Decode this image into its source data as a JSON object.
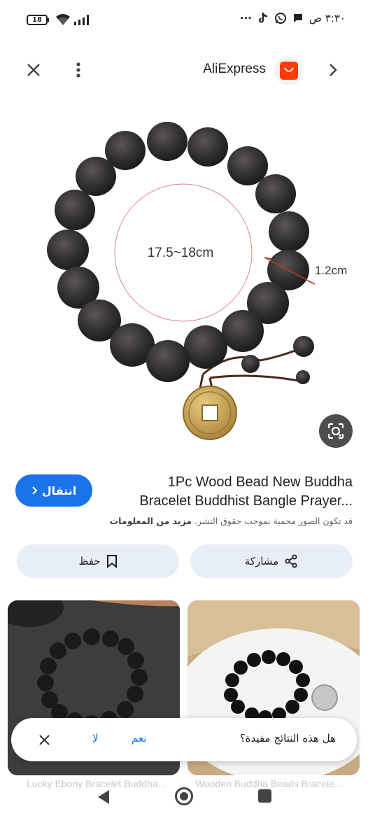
{
  "status_bar": {
    "battery": "18",
    "time": "٣:٣٠ ص",
    "more": "···"
  },
  "top_bar": {
    "site_name": "AliExpress"
  },
  "product_image": {
    "inner_diameter_label": "17.5~18cm",
    "bead_size_label": "1.2cm"
  },
  "result": {
    "title_line1": "1Pc Wood Bead New Buddha",
    "title_line2": "Bracelet Buddhist Bangle Prayer...",
    "visit_label": "انتقال",
    "copyright_text": "قد تكون الصور محمية بموجب حقوق النشر.",
    "learn_more": "مزيد من المعلومات"
  },
  "actions": {
    "share_label": "مشاركة",
    "save_label": "حفظ"
  },
  "related": [
    {
      "caption": "Lucky Ebony Bracelet Buddha..."
    },
    {
      "caption": "Wooden Buddha Beads Bracele..."
    }
  ],
  "feedback": {
    "question": "هل هذه النتائج مفيدة؟",
    "yes_label": "نعم",
    "no_label": "لا"
  },
  "colors": {
    "accent": "#1a73e8",
    "pill_bg": "#e8eef7",
    "brand": "#ff3b0a"
  }
}
